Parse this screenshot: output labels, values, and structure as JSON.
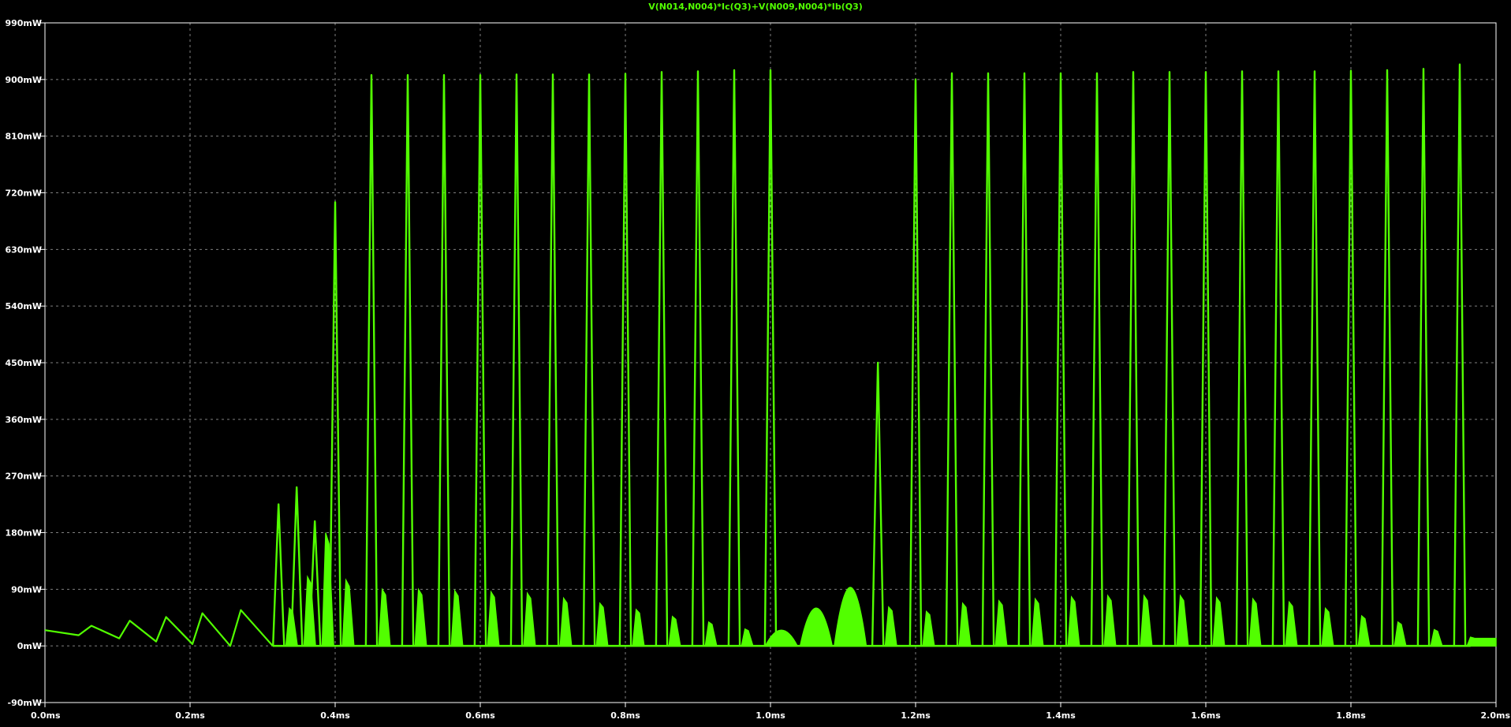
{
  "chart_data": {
    "type": "line",
    "title": "V(N014,N004)*Ic(Q3)+V(N009,N004)*Ib(Q3)",
    "xlabel": "",
    "ylabel": "",
    "xlim": [
      0,
      2.0
    ],
    "ylim": [
      -90,
      990
    ],
    "x_unit": "ms",
    "y_unit": "mW",
    "grid": true,
    "background_color": "#000000",
    "line_color": "#52FF00",
    "axis_color": "#FFFFFF",
    "grid_color": "#7F7F7F",
    "title_color": "#52FF00",
    "x_ticks": [
      {
        "value": 0.0,
        "label": "0.0ms"
      },
      {
        "value": 0.2,
        "label": "0.2ms"
      },
      {
        "value": 0.4,
        "label": "0.4ms"
      },
      {
        "value": 0.6,
        "label": "0.6ms"
      },
      {
        "value": 0.8,
        "label": "0.8ms"
      },
      {
        "value": 1.0,
        "label": "1.0ms"
      },
      {
        "value": 1.2,
        "label": "1.2ms"
      },
      {
        "value": 1.4,
        "label": "1.4ms"
      },
      {
        "value": 1.6,
        "label": "1.6ms"
      },
      {
        "value": 1.8,
        "label": "1.8ms"
      },
      {
        "value": 2.0,
        "label": "2.0ms"
      }
    ],
    "y_ticks": [
      {
        "value": -90,
        "label": "-90mW"
      },
      {
        "value": 0,
        "label": "0mW"
      },
      {
        "value": 90,
        "label": "90mW"
      },
      {
        "value": 180,
        "label": "180mW"
      },
      {
        "value": 270,
        "label": "270mW"
      },
      {
        "value": 360,
        "label": "360mW"
      },
      {
        "value": 450,
        "label": "450mW"
      },
      {
        "value": 540,
        "label": "540mW"
      },
      {
        "value": 630,
        "label": "630mW"
      },
      {
        "value": 720,
        "label": "720mW"
      },
      {
        "value": 810,
        "label": "810mW"
      },
      {
        "value": 900,
        "label": "900mW"
      },
      {
        "value": 990,
        "label": "990mW"
      }
    ],
    "series": [
      {
        "name": "V(N014,N004)*Ic(Q3)+V(N009,N004)*Ib(Q3)",
        "startup_oscillation": {
          "x_start": 0.0,
          "x_end": 0.314,
          "baseline": 25,
          "peaks": [
            {
              "x": 0.064,
              "y": 32,
              "trough": 17
            },
            {
              "x": 0.117,
              "y": 40,
              "trough": 12
            },
            {
              "x": 0.167,
              "y": 46,
              "trough": 7
            },
            {
              "x": 0.217,
              "y": 52,
              "trough": 3
            },
            {
              "x": 0.27,
              "y": 57,
              "trough": 0
            }
          ]
        },
        "pulses": [
          {
            "x": 0.322,
            "y": 225,
            "secondary": 60
          },
          {
            "x": 0.347,
            "y": 252,
            "secondary": 110
          },
          {
            "x": 0.372,
            "y": 198,
            "secondary": 180
          },
          {
            "x": 0.4,
            "y": 705,
            "secondary": 105
          },
          {
            "x": 0.45,
            "y": 907,
            "secondary": 90
          },
          {
            "x": 0.5,
            "y": 907,
            "secondary": 90
          },
          {
            "x": 0.55,
            "y": 907,
            "secondary": 88
          },
          {
            "x": 0.6,
            "y": 907,
            "secondary": 86
          },
          {
            "x": 0.65,
            "y": 908,
            "secondary": 84
          },
          {
            "x": 0.7,
            "y": 908,
            "secondary": 76
          },
          {
            "x": 0.75,
            "y": 908,
            "secondary": 68
          },
          {
            "x": 0.8,
            "y": 909,
            "secondary": 58
          },
          {
            "x": 0.85,
            "y": 912,
            "secondary": 47
          },
          {
            "x": 0.9,
            "y": 913,
            "secondary": 38
          },
          {
            "x": 0.95,
            "y": 915,
            "secondary": 27
          },
          {
            "x": 1.0,
            "y": 915,
            "secondary": 15
          },
          {
            "x": 1.148,
            "y": 450,
            "secondary": 62
          },
          {
            "x": 1.2,
            "y": 900,
            "secondary": 55
          },
          {
            "x": 1.25,
            "y": 910,
            "secondary": 68
          },
          {
            "x": 1.3,
            "y": 910,
            "secondary": 72
          },
          {
            "x": 1.35,
            "y": 910,
            "secondary": 75
          },
          {
            "x": 1.4,
            "y": 910,
            "secondary": 78
          },
          {
            "x": 1.45,
            "y": 910,
            "secondary": 80
          },
          {
            "x": 1.5,
            "y": 912,
            "secondary": 80
          },
          {
            "x": 1.55,
            "y": 912,
            "secondary": 80
          },
          {
            "x": 1.6,
            "y": 912,
            "secondary": 77
          },
          {
            "x": 1.65,
            "y": 913,
            "secondary": 75
          },
          {
            "x": 1.7,
            "y": 913,
            "secondary": 70
          },
          {
            "x": 1.75,
            "y": 913,
            "secondary": 60
          },
          {
            "x": 1.8,
            "y": 914,
            "secondary": 48
          },
          {
            "x": 1.85,
            "y": 915,
            "secondary": 38
          },
          {
            "x": 1.9,
            "y": 917,
            "secondary": 26
          },
          {
            "x": 1.95,
            "y": 924,
            "secondary": 14
          }
        ],
        "humps": [
          {
            "x": 1.015,
            "y": 25
          },
          {
            "x": 1.063,
            "y": 60
          },
          {
            "x": 1.11,
            "y": 93
          }
        ],
        "tail": {
          "x_start": 1.965,
          "x_end": 2.0,
          "y": 12
        }
      }
    ]
  }
}
